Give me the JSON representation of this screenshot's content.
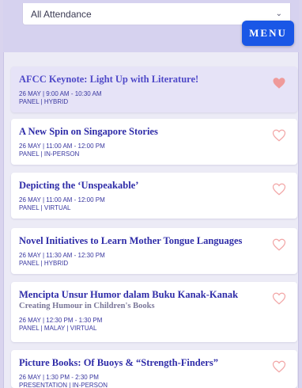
{
  "filter": {
    "value": "All Attendance"
  },
  "menu": {
    "label": "MENU"
  },
  "colors": {
    "accent": "#1a57e6",
    "title": "#2f2ca8",
    "heart_filled": "#ef9a9a",
    "heart_outline": "#f2a6a6"
  },
  "sessions": [
    {
      "title": "AFCC Keynote: Light Up with Literature!",
      "subtitle": "",
      "time": "26 MAY | 9:00 AM - 10:30 AM",
      "tags": "PANEL | HYBRID",
      "favorited": true
    },
    {
      "title": "A New Spin on Singapore Stories",
      "subtitle": "",
      "time": "26 MAY | 11:00 AM - 12:00 PM",
      "tags": "PANEL | IN-PERSON",
      "favorited": false
    },
    {
      "title": "Depicting the ‘Unspeakable’",
      "subtitle": "",
      "time": "26 MAY | 11:00 AM - 12:00 PM",
      "tags": "PANEL | VIRTUAL",
      "favorited": false
    },
    {
      "title": "Novel Initiatives to Learn Mother Tongue Languages",
      "subtitle": "",
      "time": "26 MAY | 11:30 AM - 12:30 PM",
      "tags": "PANEL | HYBRID",
      "favorited": false
    },
    {
      "title": "Mencipta Unsur Humor dalam Buku Kanak-Kanak",
      "subtitle": "Creating Humour in Children's Books",
      "time": "26 MAY | 12:30 PM - 1:30 PM",
      "tags": "PANEL | MALAY | VIRTUAL",
      "favorited": false
    },
    {
      "title": "Picture Books: Of Buoys & “Strength-Finders”",
      "subtitle": "",
      "time": "26 MAY | 1:30 PM - 2:30 PM",
      "tags": "PRESENTATION | IN-PERSON",
      "favorited": false
    }
  ]
}
